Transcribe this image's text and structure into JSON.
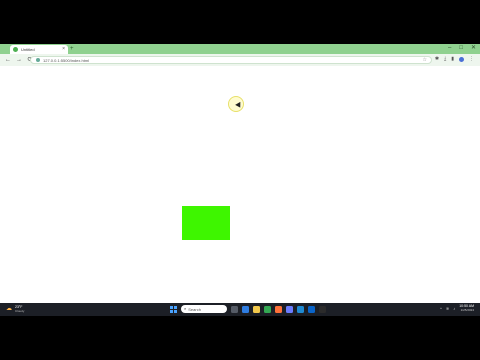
{
  "browser": {
    "tab_title": "Untitled",
    "url": "127.0.0.1:5500/index.html",
    "new_tab": "+",
    "window_controls": {
      "minimize": "–",
      "maximize": "□",
      "close": "✕"
    },
    "tab_close": "×"
  },
  "content": {
    "green_rect_color": "#3ef600"
  },
  "taskbar": {
    "weather_temp": "23°F",
    "weather_desc": "Cloudy",
    "search_placeholder": "Search",
    "time": "10:50 AM",
    "date": "1/25/2024",
    "apps": [
      {
        "name": "task-view-icon",
        "color": "#555b66"
      },
      {
        "name": "widgets-icon",
        "color": "#2f7de1"
      },
      {
        "name": "file-explorer-icon",
        "color": "#f2c94c"
      },
      {
        "name": "chrome-icon",
        "color": "#34a853"
      },
      {
        "name": "firefox-icon",
        "color": "#ff7139"
      },
      {
        "name": "store-icon",
        "color": "#6b7cff"
      },
      {
        "name": "vscode-icon",
        "color": "#1f8ad2"
      },
      {
        "name": "mail-icon",
        "color": "#0a64c9"
      },
      {
        "name": "terminal-icon",
        "color": "#2b2b2b"
      }
    ]
  }
}
